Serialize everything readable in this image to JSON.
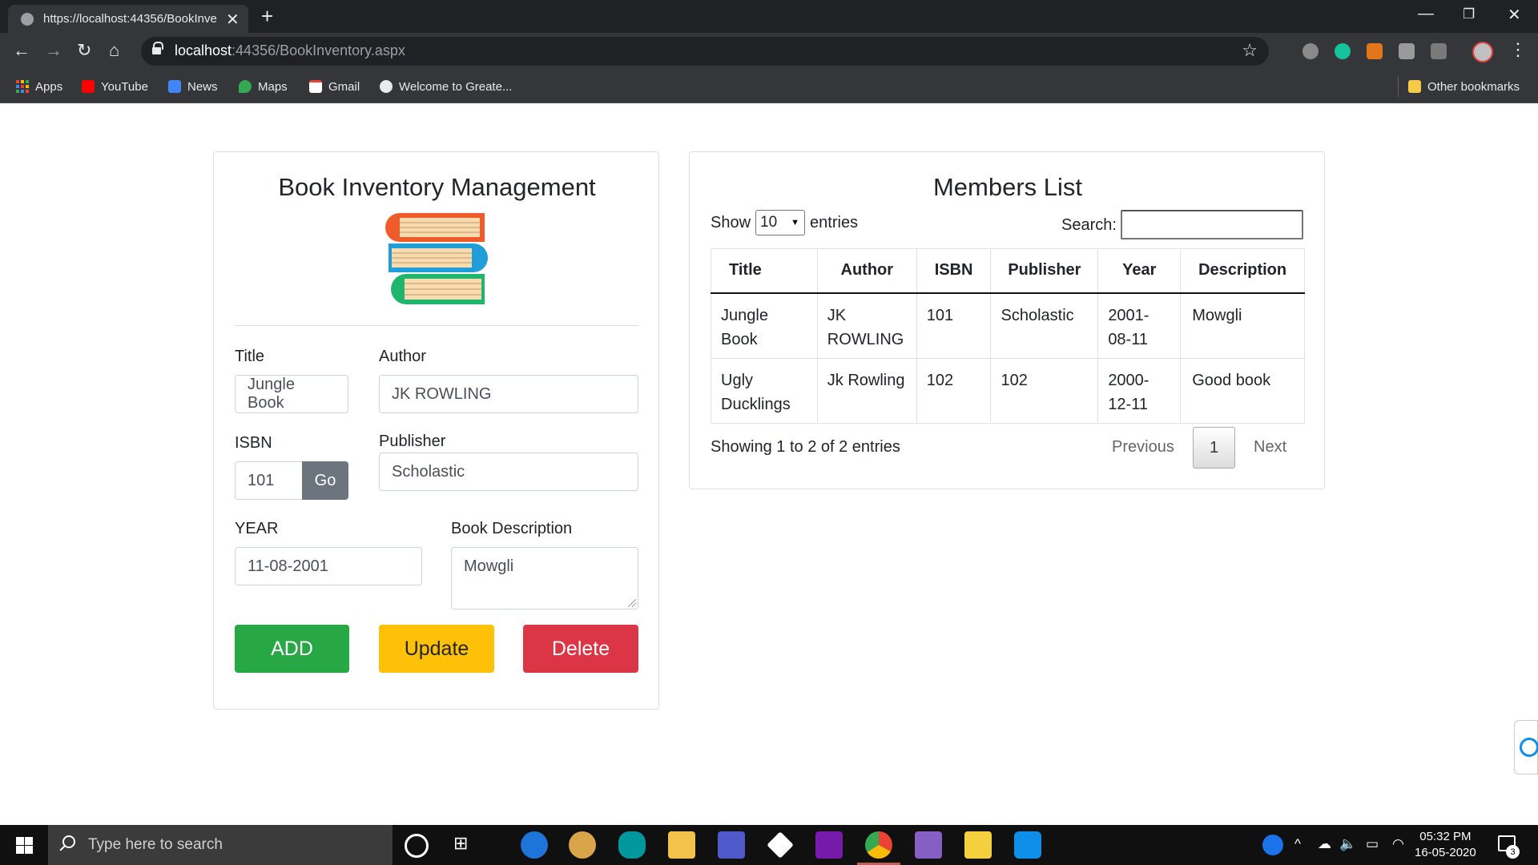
{
  "browser": {
    "tab_title": "https://localhost:44356/BookInve",
    "url_host": "localhost",
    "url_rest": ":44356/BookInventory.aspx",
    "bookmarks": [
      "Apps",
      "YouTube",
      "News",
      "Maps",
      "Gmail",
      "Welcome to Greate..."
    ],
    "other_bookmarks": "Other bookmarks"
  },
  "form": {
    "heading": "Book Inventory Management",
    "title_label": "Title",
    "title_value": "Jungle Book",
    "author_label": "Author",
    "author_value": "JK ROWLING",
    "isbn_label": "ISBN",
    "isbn_value": "101",
    "go_label": "Go",
    "publisher_label": "Publisher",
    "publisher_value": "Scholastic",
    "year_label": "YEAR",
    "year_value": "11-08-2001",
    "description_label": "Book Description",
    "description_value": "Mowgli",
    "add_label": "ADD",
    "update_label": "Update",
    "delete_label": "Delete",
    "colors": {
      "add": "#28a745",
      "update": "#ffc107",
      "delete": "#dc3545",
      "go": "#6c757d"
    }
  },
  "list": {
    "heading": "Members List",
    "show_label": "Show",
    "page_size": "10",
    "entries_label": "entries",
    "search_label": "Search:",
    "columns": [
      "Title",
      "Author",
      "ISBN",
      "Publisher",
      "Year",
      "Description"
    ],
    "rows": [
      [
        "Jungle Book",
        "JK ROWLING",
        "101",
        "Scholastic",
        "2001-08-11",
        "Mowgli"
      ],
      [
        "Ugly Ducklings",
        "Jk Rowling",
        "102",
        "102",
        "2000-12-11",
        "Good book"
      ]
    ],
    "info": "Showing 1 to 2 of 2 entries",
    "previous_label": "Previous",
    "current_page": "1",
    "next_label": "Next"
  },
  "taskbar": {
    "search_placeholder": "Type here to search",
    "time": "05:32 PM",
    "date": "16-05-2020",
    "notification_count": "3"
  }
}
